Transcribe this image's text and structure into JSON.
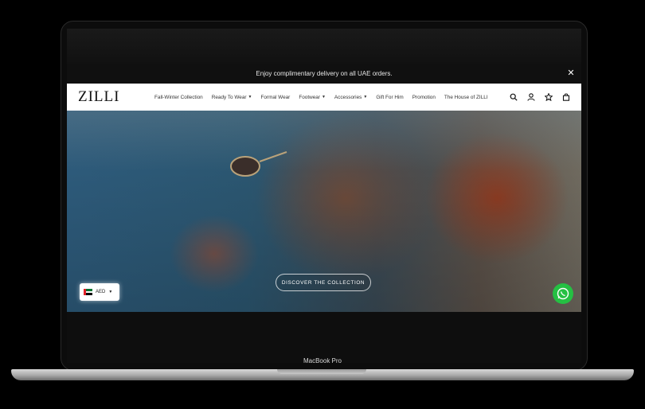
{
  "promo": {
    "text": "Enjoy complimentary delivery on all UAE orders.",
    "close_icon": "close-icon"
  },
  "nav": {
    "logo": "ZILLI",
    "items": [
      {
        "label": "Fall-Winter Collection",
        "dropdown": false
      },
      {
        "label": "Ready To Wear",
        "dropdown": true
      },
      {
        "label": "Formal Wear",
        "dropdown": false
      },
      {
        "label": "Footwear",
        "dropdown": true
      },
      {
        "label": "Accessories",
        "dropdown": true
      },
      {
        "label": "Gift For Him",
        "dropdown": false
      },
      {
        "label": "Promotion",
        "dropdown": false
      },
      {
        "label": "The House of ZILLI",
        "dropdown": false
      }
    ],
    "icons": [
      "search-icon",
      "account-icon",
      "wishlist-star-icon",
      "cart-bag-icon"
    ]
  },
  "hero": {
    "cta_label": "DISCOVER THE COLLECTION"
  },
  "currency": {
    "code": "AED",
    "flag": "uae-flag-icon"
  },
  "device": {
    "label": "MacBook Pro"
  },
  "colors": {
    "whatsapp": "#25c043",
    "uae_red": "#e21f26",
    "uae_green": "#00732f"
  }
}
